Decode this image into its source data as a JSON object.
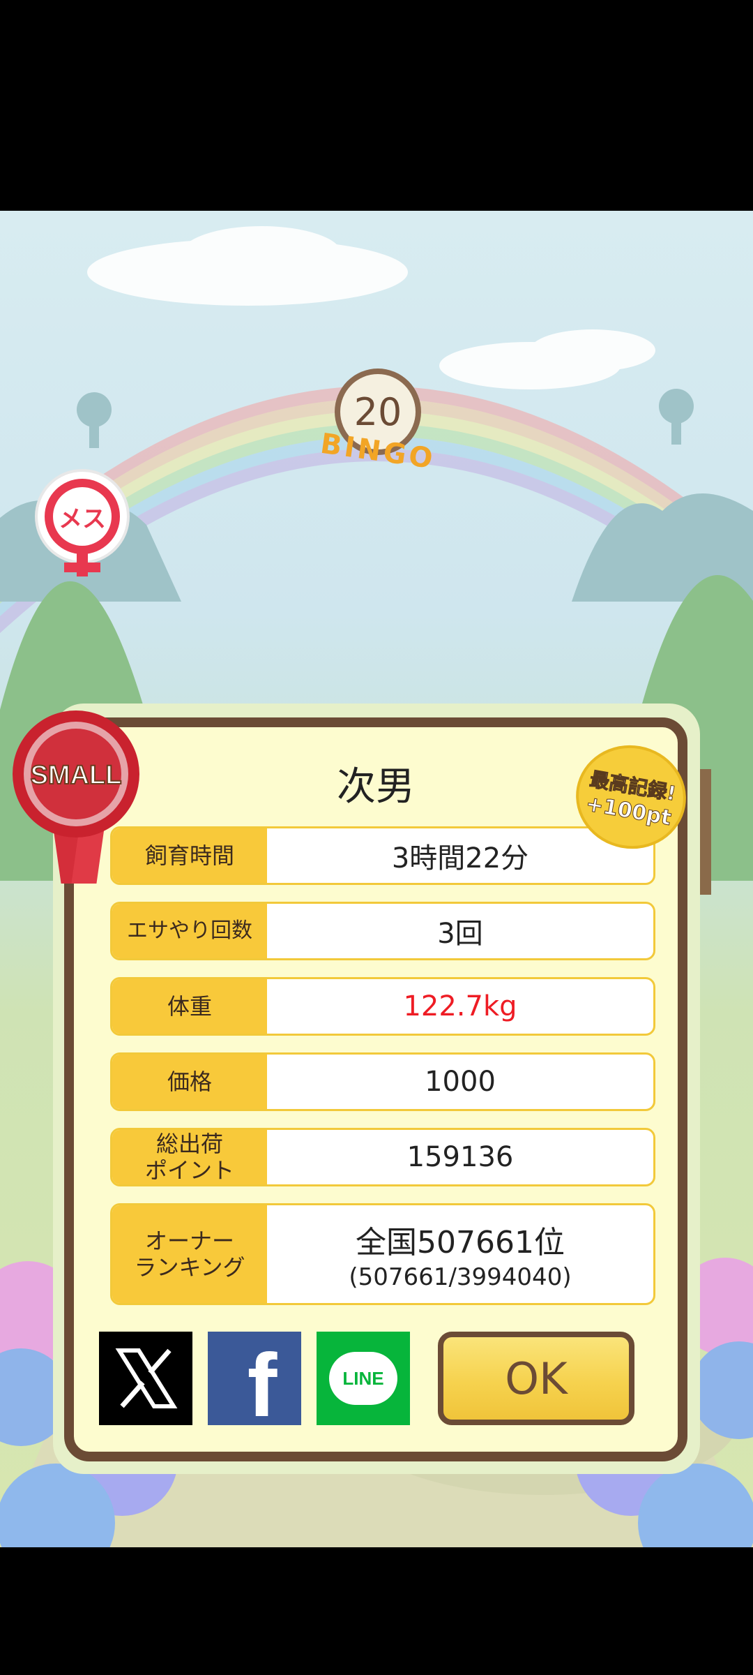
{
  "bingo": {
    "number": "20",
    "word": "BINGO"
  },
  "badges": {
    "gender": "メス",
    "size_ribbon": "SMALL",
    "record_stamp_line1": "最高記録!",
    "record_stamp_line2": "+100pt"
  },
  "panel": {
    "title": "次男",
    "rows": [
      {
        "label": "飼育時間",
        "value": "3時間22分"
      },
      {
        "label": "エサやり回数",
        "value": "3回"
      },
      {
        "label": "体重",
        "value": "122.7kg"
      },
      {
        "label": "価格",
        "value": "1000"
      },
      {
        "label_line1": "総出荷",
        "label_line2": "ポイント",
        "value": "159136"
      },
      {
        "label_line1": "オーナー",
        "label_line2": "ランキング",
        "value": "全国507661位",
        "value_sub": "(507661/3994040)"
      }
    ]
  },
  "share": {
    "line_label": "LINE",
    "facebook_label": "f"
  },
  "ok_button": {
    "label": "OK"
  },
  "colors": {
    "panel_border": "#6b4b35",
    "label_bg": "#f8c93a",
    "weight_value": "#ee1c24",
    "line_green": "#07b53b",
    "facebook_blue": "#3b5998"
  }
}
